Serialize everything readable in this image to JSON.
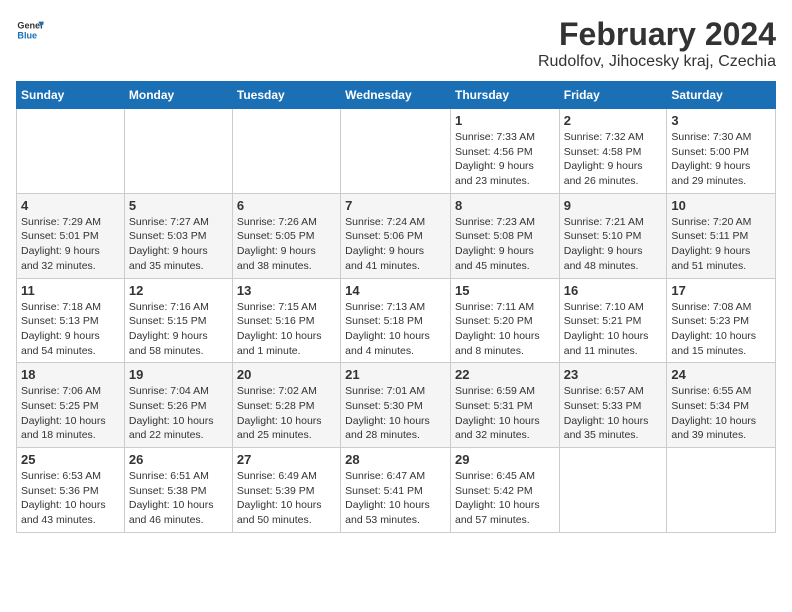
{
  "logo": {
    "line1": "General",
    "line2": "Blue"
  },
  "title": "February 2024",
  "subtitle": "Rudolfov, Jihocesky kraj, Czechia",
  "days_of_week": [
    "Sunday",
    "Monday",
    "Tuesday",
    "Wednesday",
    "Thursday",
    "Friday",
    "Saturday"
  ],
  "weeks": [
    {
      "days": [
        {
          "num": "",
          "info": ""
        },
        {
          "num": "",
          "info": ""
        },
        {
          "num": "",
          "info": ""
        },
        {
          "num": "",
          "info": ""
        },
        {
          "num": "1",
          "info": "Sunrise: 7:33 AM\nSunset: 4:56 PM\nDaylight: 9 hours\nand 23 minutes."
        },
        {
          "num": "2",
          "info": "Sunrise: 7:32 AM\nSunset: 4:58 PM\nDaylight: 9 hours\nand 26 minutes."
        },
        {
          "num": "3",
          "info": "Sunrise: 7:30 AM\nSunset: 5:00 PM\nDaylight: 9 hours\nand 29 minutes."
        }
      ]
    },
    {
      "days": [
        {
          "num": "4",
          "info": "Sunrise: 7:29 AM\nSunset: 5:01 PM\nDaylight: 9 hours\nand 32 minutes."
        },
        {
          "num": "5",
          "info": "Sunrise: 7:27 AM\nSunset: 5:03 PM\nDaylight: 9 hours\nand 35 minutes."
        },
        {
          "num": "6",
          "info": "Sunrise: 7:26 AM\nSunset: 5:05 PM\nDaylight: 9 hours\nand 38 minutes."
        },
        {
          "num": "7",
          "info": "Sunrise: 7:24 AM\nSunset: 5:06 PM\nDaylight: 9 hours\nand 41 minutes."
        },
        {
          "num": "8",
          "info": "Sunrise: 7:23 AM\nSunset: 5:08 PM\nDaylight: 9 hours\nand 45 minutes."
        },
        {
          "num": "9",
          "info": "Sunrise: 7:21 AM\nSunset: 5:10 PM\nDaylight: 9 hours\nand 48 minutes."
        },
        {
          "num": "10",
          "info": "Sunrise: 7:20 AM\nSunset: 5:11 PM\nDaylight: 9 hours\nand 51 minutes."
        }
      ]
    },
    {
      "days": [
        {
          "num": "11",
          "info": "Sunrise: 7:18 AM\nSunset: 5:13 PM\nDaylight: 9 hours\nand 54 minutes."
        },
        {
          "num": "12",
          "info": "Sunrise: 7:16 AM\nSunset: 5:15 PM\nDaylight: 9 hours\nand 58 minutes."
        },
        {
          "num": "13",
          "info": "Sunrise: 7:15 AM\nSunset: 5:16 PM\nDaylight: 10 hours\nand 1 minute."
        },
        {
          "num": "14",
          "info": "Sunrise: 7:13 AM\nSunset: 5:18 PM\nDaylight: 10 hours\nand 4 minutes."
        },
        {
          "num": "15",
          "info": "Sunrise: 7:11 AM\nSunset: 5:20 PM\nDaylight: 10 hours\nand 8 minutes."
        },
        {
          "num": "16",
          "info": "Sunrise: 7:10 AM\nSunset: 5:21 PM\nDaylight: 10 hours\nand 11 minutes."
        },
        {
          "num": "17",
          "info": "Sunrise: 7:08 AM\nSunset: 5:23 PM\nDaylight: 10 hours\nand 15 minutes."
        }
      ]
    },
    {
      "days": [
        {
          "num": "18",
          "info": "Sunrise: 7:06 AM\nSunset: 5:25 PM\nDaylight: 10 hours\nand 18 minutes."
        },
        {
          "num": "19",
          "info": "Sunrise: 7:04 AM\nSunset: 5:26 PM\nDaylight: 10 hours\nand 22 minutes."
        },
        {
          "num": "20",
          "info": "Sunrise: 7:02 AM\nSunset: 5:28 PM\nDaylight: 10 hours\nand 25 minutes."
        },
        {
          "num": "21",
          "info": "Sunrise: 7:01 AM\nSunset: 5:30 PM\nDaylight: 10 hours\nand 28 minutes."
        },
        {
          "num": "22",
          "info": "Sunrise: 6:59 AM\nSunset: 5:31 PM\nDaylight: 10 hours\nand 32 minutes."
        },
        {
          "num": "23",
          "info": "Sunrise: 6:57 AM\nSunset: 5:33 PM\nDaylight: 10 hours\nand 35 minutes."
        },
        {
          "num": "24",
          "info": "Sunrise: 6:55 AM\nSunset: 5:34 PM\nDaylight: 10 hours\nand 39 minutes."
        }
      ]
    },
    {
      "days": [
        {
          "num": "25",
          "info": "Sunrise: 6:53 AM\nSunset: 5:36 PM\nDaylight: 10 hours\nand 43 minutes."
        },
        {
          "num": "26",
          "info": "Sunrise: 6:51 AM\nSunset: 5:38 PM\nDaylight: 10 hours\nand 46 minutes."
        },
        {
          "num": "27",
          "info": "Sunrise: 6:49 AM\nSunset: 5:39 PM\nDaylight: 10 hours\nand 50 minutes."
        },
        {
          "num": "28",
          "info": "Sunrise: 6:47 AM\nSunset: 5:41 PM\nDaylight: 10 hours\nand 53 minutes."
        },
        {
          "num": "29",
          "info": "Sunrise: 6:45 AM\nSunset: 5:42 PM\nDaylight: 10 hours\nand 57 minutes."
        },
        {
          "num": "",
          "info": ""
        },
        {
          "num": "",
          "info": ""
        }
      ]
    }
  ]
}
